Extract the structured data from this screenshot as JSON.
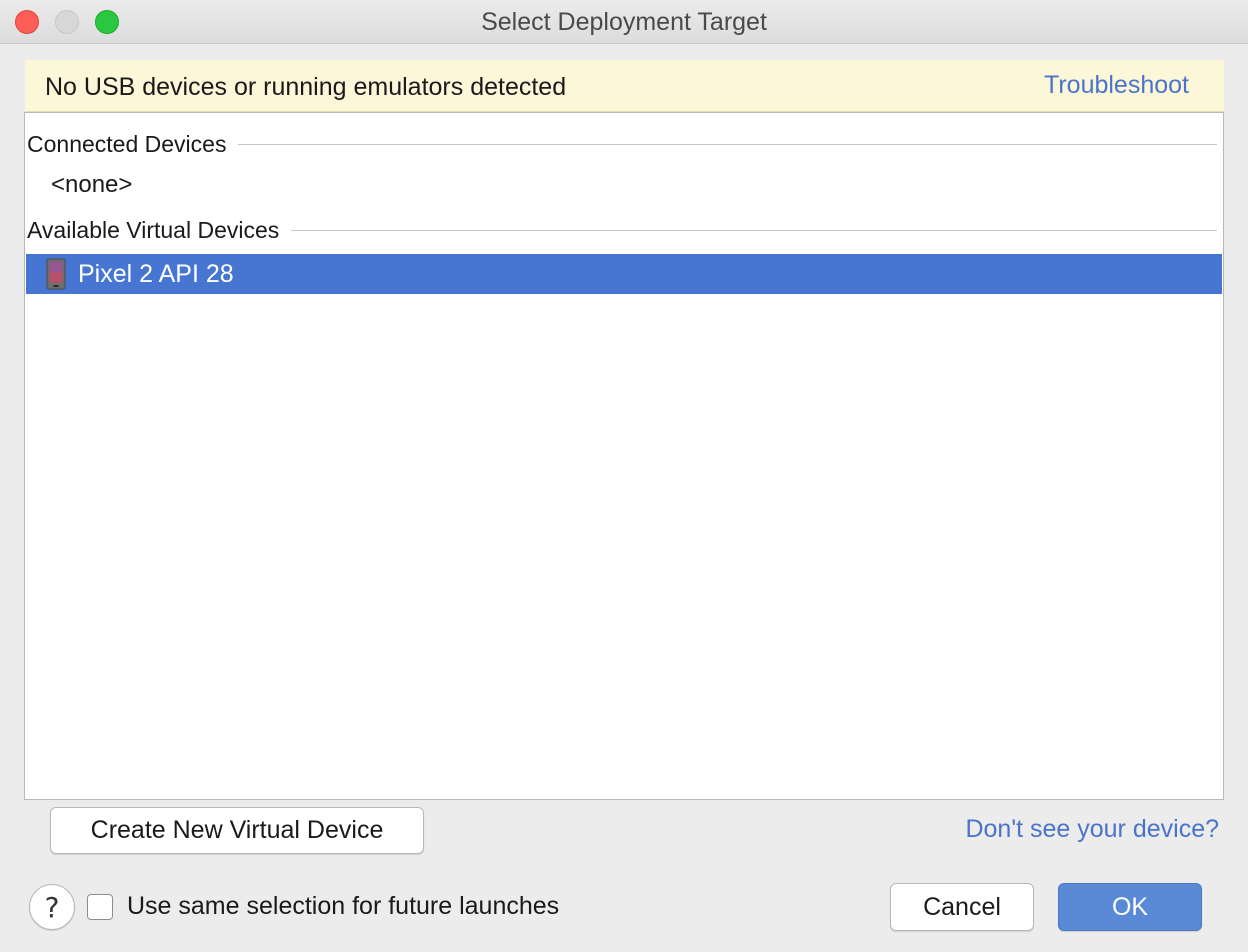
{
  "window": {
    "title": "Select Deployment Target"
  },
  "banner": {
    "message": "No USB devices or running emulators detected",
    "link": "Troubleshoot"
  },
  "device_list": {
    "connected": {
      "header": "Connected Devices",
      "empty_label": "<none>"
    },
    "available": {
      "header": "Available Virtual Devices",
      "items": [
        {
          "name": "Pixel 2 API 28",
          "icon": "phone-icon",
          "selected": true
        }
      ]
    }
  },
  "actions": {
    "create_label": "Create New Virtual Device",
    "help_link": "Don't see your device?",
    "help_symbol": "?",
    "checkbox_label": "Use same selection for future launches",
    "checkbox_checked": false,
    "cancel_label": "Cancel",
    "ok_label": "OK"
  },
  "colors": {
    "selection": "#4676d2",
    "link": "#4a74c9",
    "banner_bg": "#fdf7d9",
    "ok_button": "#5a8ad6"
  }
}
